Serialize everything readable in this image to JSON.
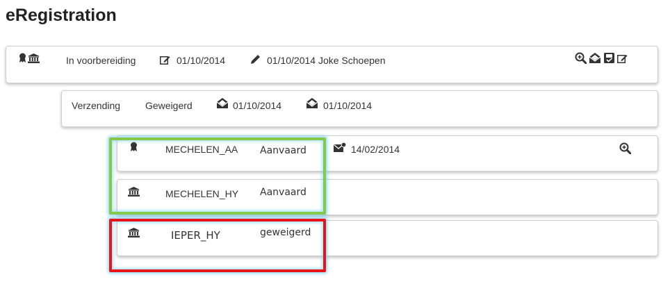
{
  "page": {
    "title": "eRegistration"
  },
  "dossier": {
    "icons": [
      "award-icon",
      "bank-icon"
    ],
    "status": "In voorbereiding",
    "created_icon": "edit-icon",
    "created_date": "01/10/2014",
    "modified_icon": "pencil-icon",
    "modified_text": "01/10/2014 Joke Schoepen",
    "actions": [
      "zoom-in-icon",
      "mail-opened-icon",
      "save-icon",
      "edit-icon"
    ]
  },
  "verzending": {
    "label": "Verzending",
    "status": "Geweigerd",
    "sent_icon": "mail-opened-icon",
    "sent_date": "01/10/2014",
    "received_icon": "mail-opened-icon",
    "received_date": "01/10/2014"
  },
  "items": [
    {
      "icon": "award-icon",
      "name": "MECHELEN_AA",
      "status": "Aanvaard",
      "mail_icon": "mail-check-icon",
      "date": "14/02/2014",
      "action": "zoom-in-icon"
    },
    {
      "icon": "bank-icon",
      "name": "MECHELEN_HY",
      "status": "Aanvaard"
    },
    {
      "icon": "bank-icon",
      "name": "IEPER_HY",
      "status": "geweigerd"
    }
  ],
  "colors": {
    "highlight_green": "#86c94a",
    "highlight_red": "#e8131b",
    "glow": "#78d2f0",
    "icon": "#333333"
  }
}
